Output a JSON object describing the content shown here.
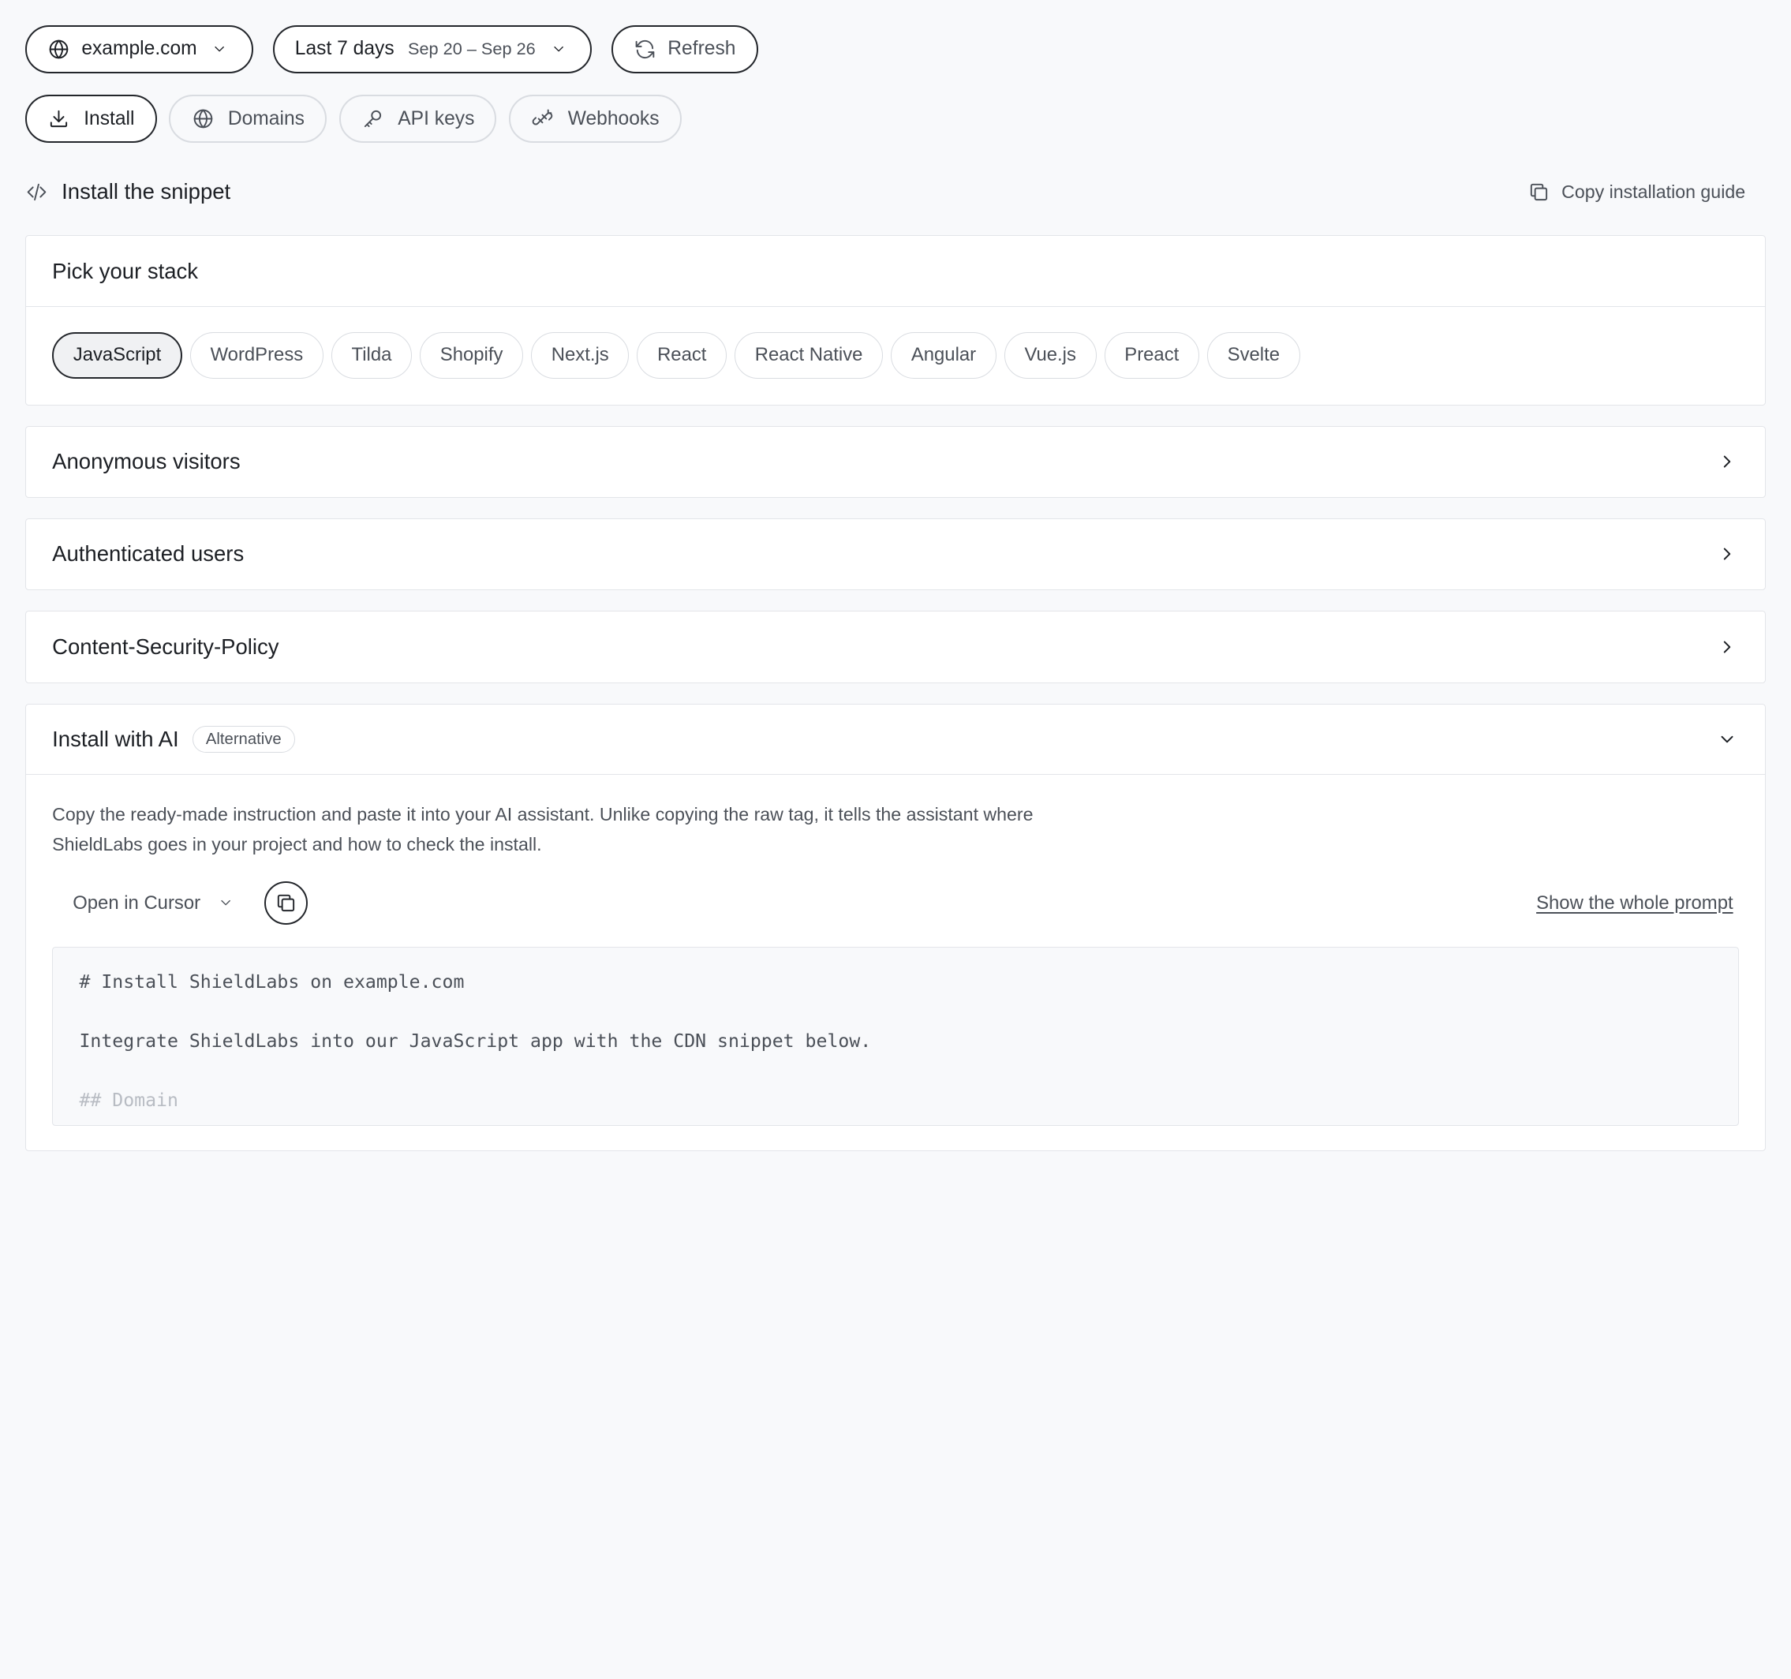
{
  "toolbar": {
    "domain": "example.com",
    "range_label": "Last 7 days",
    "range_dates": "Sep 20 – Sep 26",
    "refresh": "Refresh"
  },
  "tabs": [
    {
      "label": "Install",
      "icon": "download-icon",
      "active": true
    },
    {
      "label": "Domains",
      "icon": "globe-icon",
      "active": false
    },
    {
      "label": "API keys",
      "icon": "key-icon",
      "active": false
    },
    {
      "label": "Webhooks",
      "icon": "webhook-icon",
      "active": false
    }
  ],
  "section": {
    "title": "Install the snippet",
    "copy_guide": "Copy installation guide"
  },
  "stack": {
    "title": "Pick your stack",
    "options": [
      "JavaScript",
      "WordPress",
      "Tilda",
      "Shopify",
      "Next.js",
      "React",
      "React Native",
      "Angular",
      "Vue.js",
      "Preact",
      "Svelte"
    ],
    "selected": "JavaScript"
  },
  "accordions": [
    {
      "title": "Anonymous visitors",
      "expanded": false
    },
    {
      "title": "Authenticated users",
      "expanded": false
    },
    {
      "title": "Content-Security-Policy",
      "expanded": false
    }
  ],
  "ai": {
    "title": "Install with AI",
    "badge": "Alternative",
    "description_line1": "Copy the ready-made instruction and paste it into your AI assistant. Unlike copying the raw tag, it tells the assistant where",
    "description_line2": "ShieldLabs goes in your project and how to check the install.",
    "open_in": "Open in Cursor",
    "show_prompt": "Show the whole prompt",
    "code": {
      "line1": "# Install ShieldLabs on example.com",
      "line2": "Integrate ShieldLabs into our JavaScript app with the CDN snippet below.",
      "line3": "## Domain"
    }
  },
  "colors": {
    "background": "#f8f9fb",
    "border": "#e3e5e9",
    "text_primary": "#1c1f24",
    "text_secondary": "#4b5058"
  }
}
